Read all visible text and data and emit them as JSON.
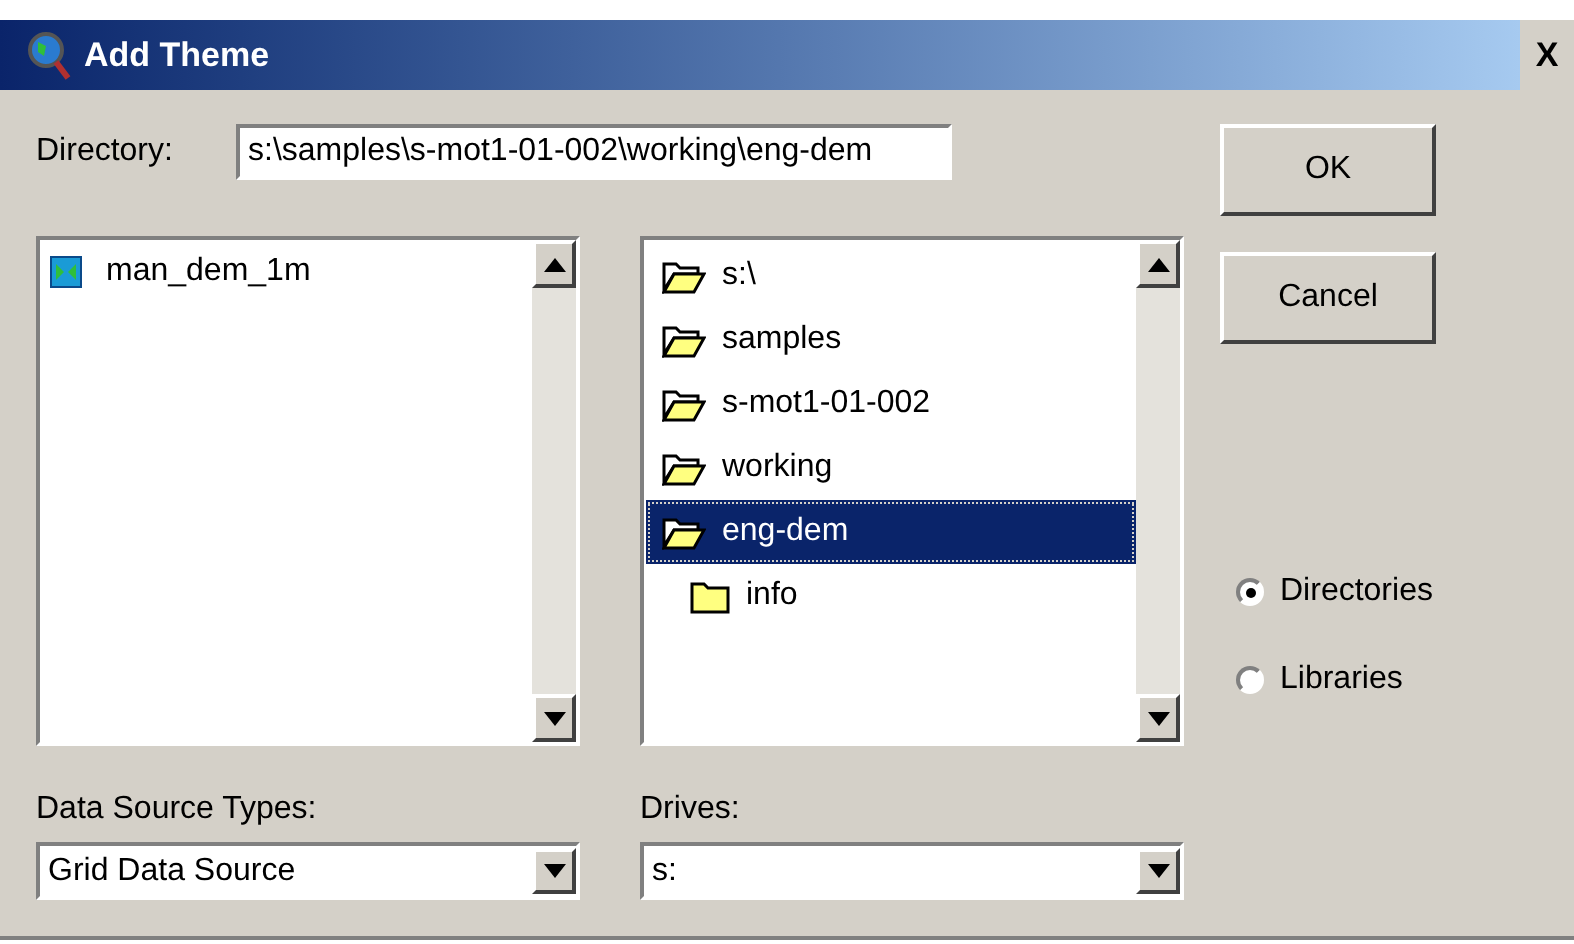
{
  "window": {
    "title": "Add Theme",
    "close": "X"
  },
  "directory": {
    "label": "Directory:",
    "value": "s:\\samples\\s-mot1-01-002\\working\\eng-dem"
  },
  "files": [
    {
      "name": "man_dem_1m",
      "selected": false
    }
  ],
  "folders": [
    {
      "name": "s:\\",
      "kind": "open",
      "selected": false
    },
    {
      "name": "samples",
      "kind": "open",
      "selected": false
    },
    {
      "name": "s-mot1-01-002",
      "kind": "open",
      "selected": false
    },
    {
      "name": "working",
      "kind": "open",
      "selected": false
    },
    {
      "name": "eng-dem",
      "kind": "open",
      "selected": true
    },
    {
      "name": "info",
      "kind": "closed",
      "selected": false
    }
  ],
  "buttons": [
    "OK",
    "Cancel"
  ],
  "view_options": [
    {
      "label": "Directories",
      "selected": true
    },
    {
      "label": "Libraries",
      "selected": false
    }
  ],
  "data_source_types": {
    "label": "Data Source Types:",
    "value": "Grid Data Source"
  },
  "drives": {
    "label": "Drives:",
    "value": "s:"
  }
}
